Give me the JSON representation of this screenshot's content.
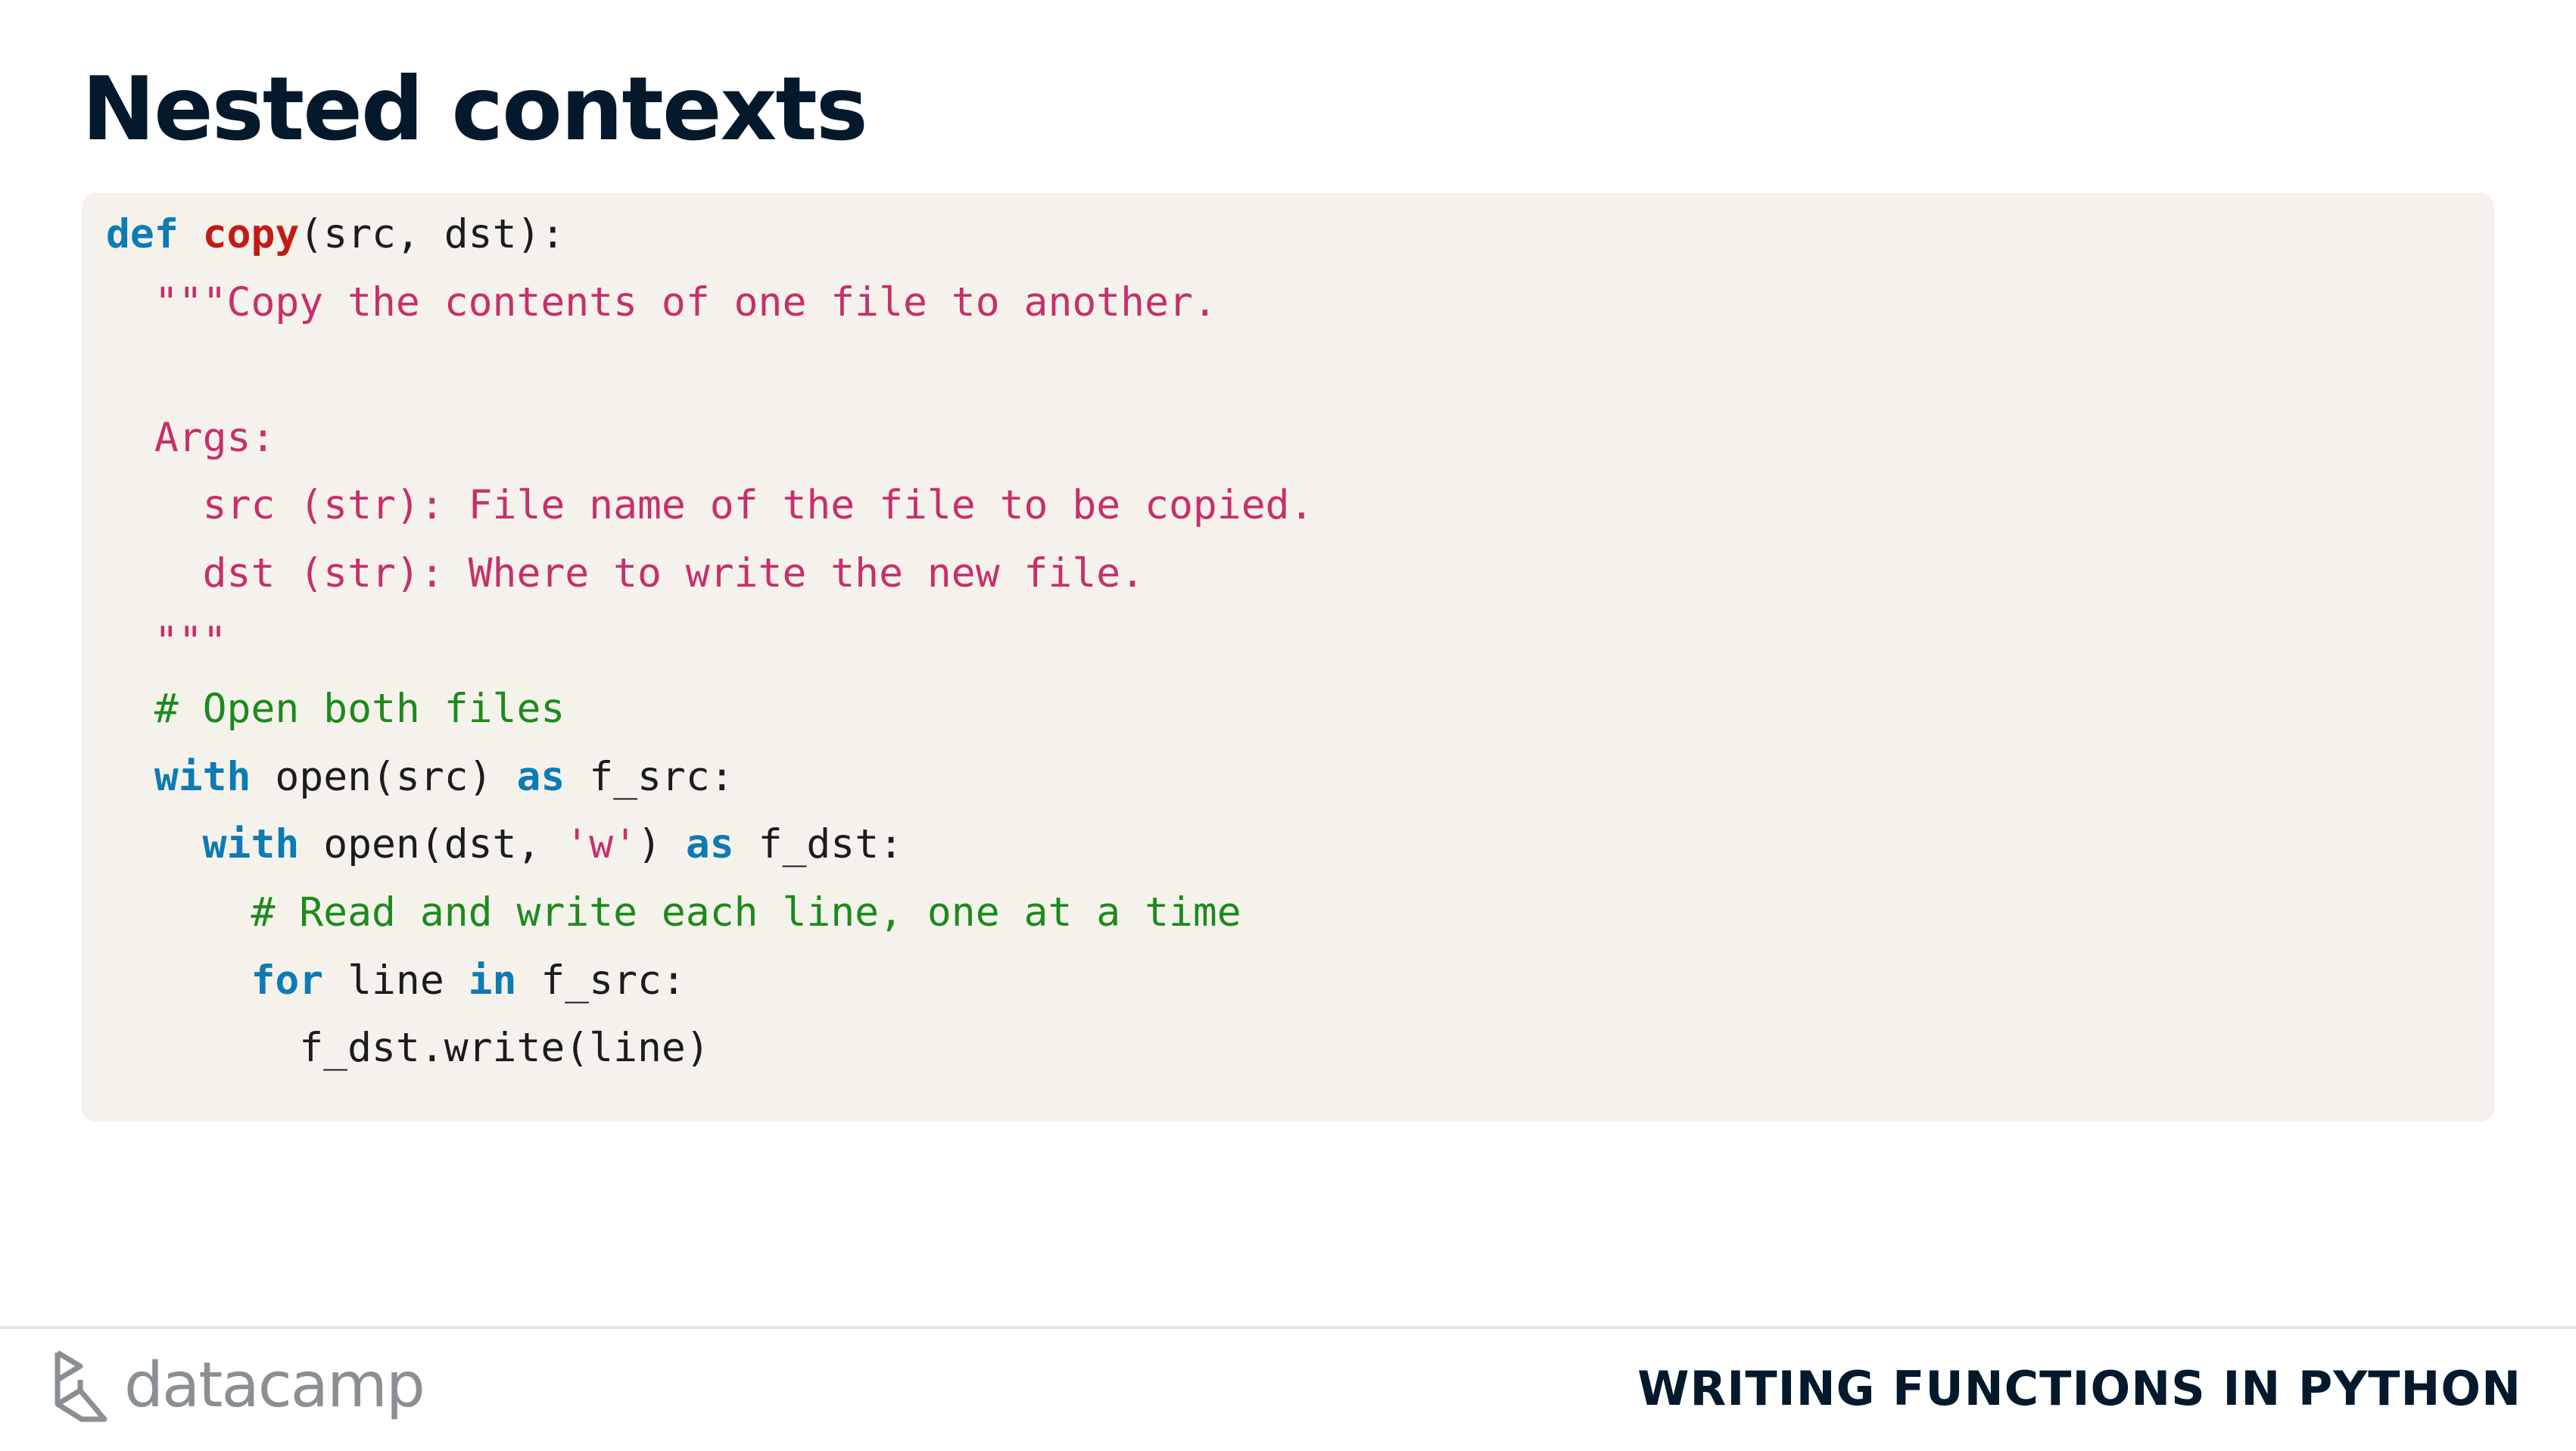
{
  "slide": {
    "title": "Nested contexts"
  },
  "code": {
    "lines": [
      [
        {
          "t": "kw",
          "v": "def"
        },
        {
          "t": "plain",
          "v": " "
        },
        {
          "t": "fn",
          "v": "copy"
        },
        {
          "t": "plain",
          "v": "(src, dst):"
        }
      ],
      [
        {
          "t": "str",
          "v": "  \"\"\"Copy the contents of one file to another."
        }
      ],
      [],
      [
        {
          "t": "str",
          "v": "  Args:"
        }
      ],
      [
        {
          "t": "str",
          "v": "    src (str): File name of the file to be copied."
        }
      ],
      [
        {
          "t": "str",
          "v": "    dst (str): Where to write the new file."
        }
      ],
      [
        {
          "t": "str",
          "v": "  \"\"\""
        }
      ],
      [
        {
          "t": "com",
          "v": "  # Open both files"
        }
      ],
      [
        {
          "t": "plain",
          "v": "  "
        },
        {
          "t": "kw",
          "v": "with"
        },
        {
          "t": "plain",
          "v": " open(src) "
        },
        {
          "t": "kw",
          "v": "as"
        },
        {
          "t": "plain",
          "v": " f_src:"
        }
      ],
      [
        {
          "t": "plain",
          "v": "    "
        },
        {
          "t": "kw",
          "v": "with"
        },
        {
          "t": "plain",
          "v": " open(dst, "
        },
        {
          "t": "str",
          "v": "'w'"
        },
        {
          "t": "plain",
          "v": ") "
        },
        {
          "t": "kw",
          "v": "as"
        },
        {
          "t": "plain",
          "v": " f_dst:"
        }
      ],
      [
        {
          "t": "com",
          "v": "      # Read and write each line, one at a time"
        }
      ],
      [
        {
          "t": "plain",
          "v": "      "
        },
        {
          "t": "kw",
          "v": "for"
        },
        {
          "t": "plain",
          "v": " line "
        },
        {
          "t": "kw",
          "v": "in"
        },
        {
          "t": "plain",
          "v": " f_src:"
        }
      ],
      [
        {
          "t": "plain",
          "v": "        f_dst.write(line)"
        }
      ]
    ]
  },
  "footer": {
    "logo_text": "datacamp",
    "logo_icon": "datacamp-logo-icon",
    "course_title": "WRITING FUNCTIONS IN PYTHON"
  },
  "colors": {
    "title": "#05192d",
    "code_bg": "#f5f2eb",
    "keyword": "#0d7bb5",
    "function": "#c41a16",
    "string": "#c72f6b",
    "comment": "#1c8a1c",
    "logo": "#8a8f94"
  }
}
